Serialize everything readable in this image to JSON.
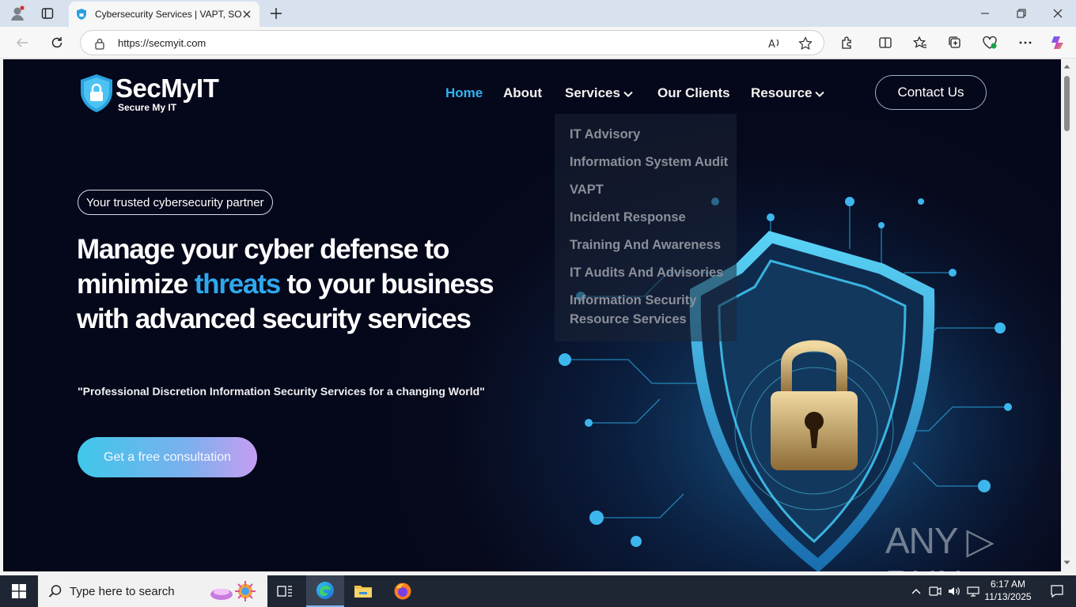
{
  "browser": {
    "tab_title": "Cybersecurity Services | VAPT, SOC",
    "url": "https://secmyit.com"
  },
  "site": {
    "logo_name": "SecMyIT",
    "logo_tagline": "Secure My IT",
    "nav": {
      "home": "Home",
      "about": "About",
      "services": "Services",
      "clients": "Our Clients",
      "resource": "Resource"
    },
    "contact_button": "Contact Us",
    "services_menu": [
      "IT Advisory",
      "Information System Audit",
      "VAPT",
      "Incident Response",
      "Training And Awareness",
      "IT Audits And Advisories",
      "Information Security",
      "Resource Services"
    ],
    "hero": {
      "badge": "Your trusted cybersecurity partner",
      "headline_part1": "Manage your cyber defense to minimize",
      "headline_highlight": "threats",
      "headline_part2": "to your business with advanced security services",
      "quote": "\"Professional Discretion Information Security Services for a changing World\"",
      "cta": "Get a free consultation"
    },
    "watermark": "ANY ▷ RUN"
  },
  "taskbar": {
    "search_placeholder": "Type here to search",
    "time": "6:17 AM",
    "date": "11/13/2025"
  },
  "colors": {
    "accent": "#2fb4f0",
    "page_bg": "#05071a",
    "cta_start": "#3fc7ea",
    "cta_end": "#c59ef0"
  }
}
